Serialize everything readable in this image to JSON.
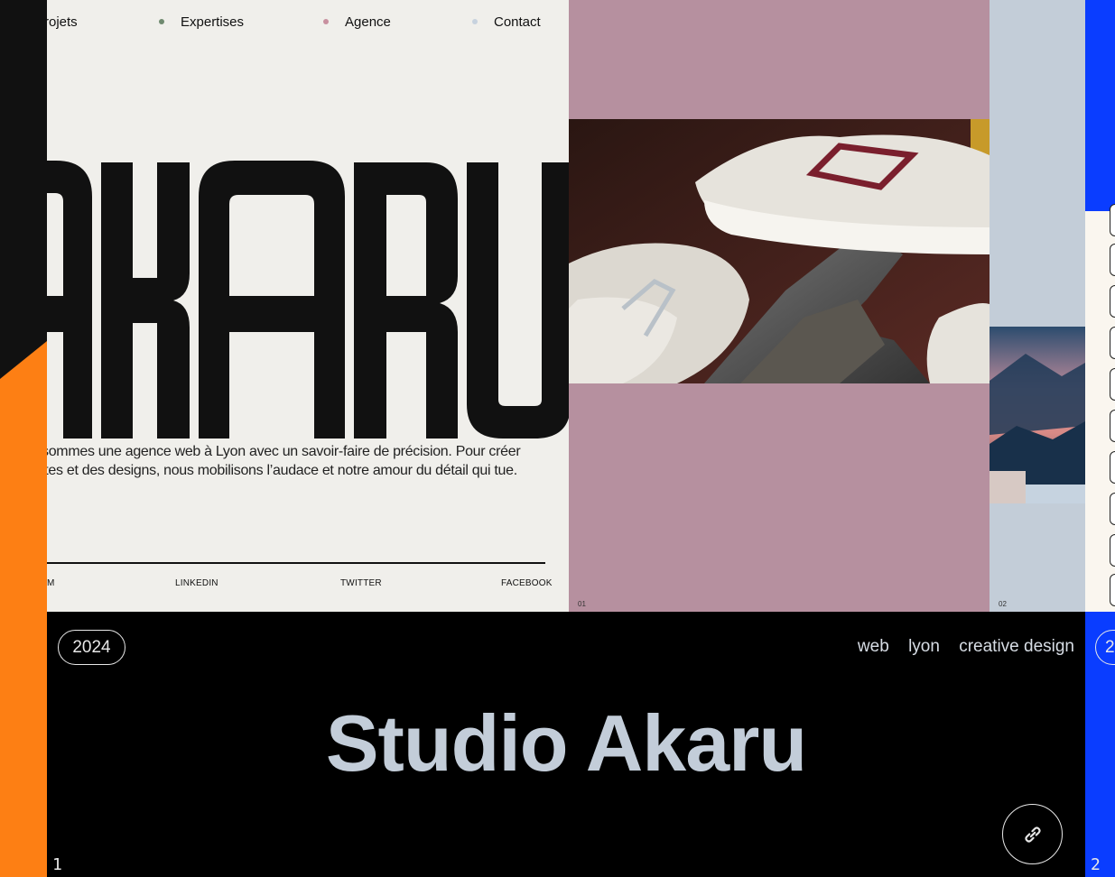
{
  "slide1": {
    "nav": [
      {
        "label": "rojets",
        "dot_color": ""
      },
      {
        "label": "Expertises",
        "dot_color": "#6f8a6f"
      },
      {
        "label": "Agence",
        "dot_color": "#c8909f"
      },
      {
        "label": "Contact",
        "dot_color": "#c7d2de"
      }
    ],
    "logo_text": "AKARU",
    "tagline_line1": "sommes une agence web à Lyon avec un savoir-faire de précision. Pour créer",
    "tagline_line2": "ites et des designs, nous mobilisons l’audace et notre amour du détail qui tue.",
    "social": [
      "M",
      "LINKEDIN",
      "TWITTER",
      "FACEBOOK"
    ],
    "panel_numbers": [
      "01",
      "02"
    ],
    "colors": {
      "cream": "#f0efeb",
      "mauve": "#b6909f",
      "light_blue": "#c3cdd8",
      "orange": "#fd7f14"
    }
  },
  "caption": {
    "year": "2024",
    "tags": [
      "web",
      "lyon",
      "creative design"
    ],
    "title": "Studio Akaru",
    "link_icon": "link-icon",
    "index": "1"
  },
  "slide2": {
    "year_partial": "2",
    "index": "2",
    "accent": "#0a3dff"
  }
}
